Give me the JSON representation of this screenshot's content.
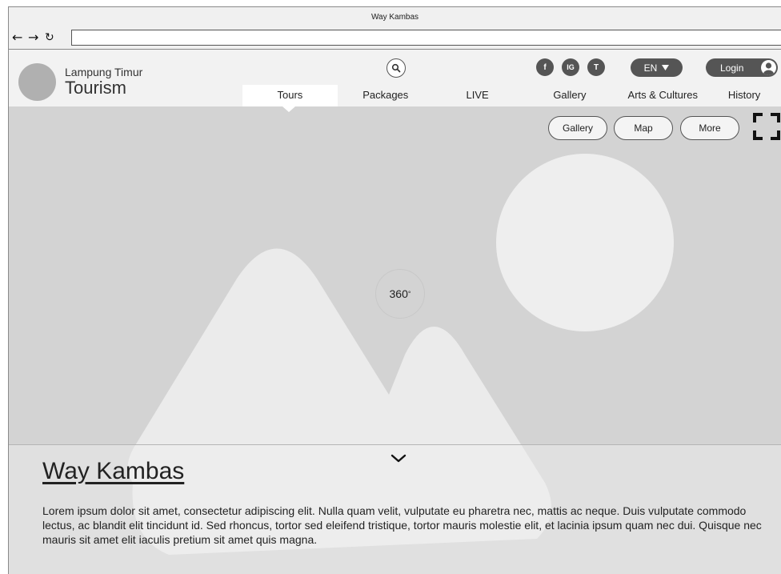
{
  "window": {
    "title": "Way Kambas"
  },
  "browser": {
    "back": "←",
    "forward": "→",
    "reload": "↻",
    "url": ""
  },
  "header": {
    "brand_sub": "Lampung Timur",
    "brand_main": "Tourism",
    "social": [
      "f",
      "IG",
      "T"
    ],
    "language": "EN",
    "login": "Login"
  },
  "menu": {
    "items": [
      "Tours",
      "Packages",
      "LIVE",
      "Gallery",
      "Arts & Cultures",
      "History"
    ],
    "active_index": 0
  },
  "hero": {
    "buttons": [
      "Gallery",
      "Map",
      "More"
    ],
    "badge": "360",
    "badge_sup": "°"
  },
  "place": {
    "title": "Way Kambas",
    "description": "Lorem ipsum dolor sit amet, consectetur adipiscing elit. Nulla quam velit, vulputate eu pharetra nec, mattis ac neque. Duis vulputate commodo lectus, ac blandit elit tincidunt id. Sed rhoncus, tortor sed eleifend tristique, tortor mauris molestie elit, et lacinia ipsum quam nec dui. Quisque nec mauris sit amet elit iaculis pretium sit amet quis magna."
  },
  "colors": {
    "dark_button": "#555555",
    "hero_bg": "#d3d3d3",
    "header_bg": "#f2f2f2"
  }
}
